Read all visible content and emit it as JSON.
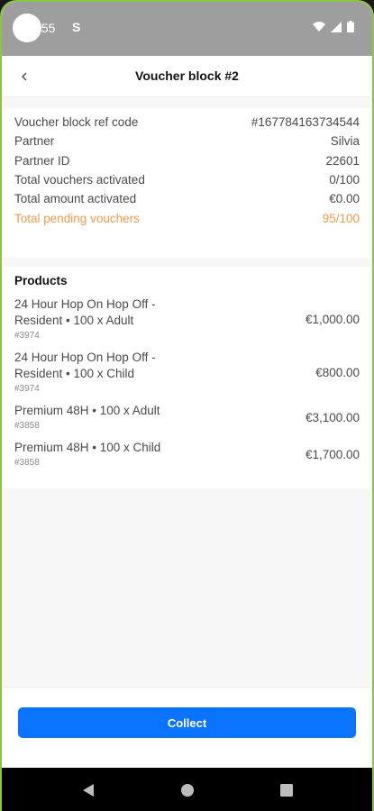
{
  "status_bar": {
    "time": ":55",
    "s_label": "S"
  },
  "header": {
    "title": "Voucher block #2",
    "back_icon": "chevron-left-icon"
  },
  "info": [
    {
      "label": "Voucher block ref code",
      "value": "#167784163734544"
    },
    {
      "label": "Partner",
      "value": "Silvia"
    },
    {
      "label": "Partner ID",
      "value": "22601"
    },
    {
      "label": "Total vouchers activated",
      "value": "0/100"
    },
    {
      "label": "Total amount activated",
      "value": "€0.00"
    },
    {
      "label": "Total pending vouchers",
      "value": "95/100"
    }
  ],
  "products": {
    "title": "Products",
    "items": [
      {
        "name": "24 Hour Hop On Hop Off - Resident • 100 x Adult",
        "code": "#3974",
        "price": "€1,000.00"
      },
      {
        "name": "24 Hour Hop On Hop Off - Resident • 100 x Child",
        "code": "#3974",
        "price": "€800.00"
      },
      {
        "name": "Premium 48H • 100 x Adult",
        "code": "#3858",
        "price": "€3,100.00"
      },
      {
        "name": "Premium 48H • 100 x Child",
        "code": "#3858",
        "price": "€1,700.00"
      }
    ]
  },
  "actions": {
    "collect_label": "Collect"
  },
  "colors": {
    "accent": "#0a74ff",
    "pending": "#f2994a",
    "status_bar": "#9e9e9e"
  }
}
